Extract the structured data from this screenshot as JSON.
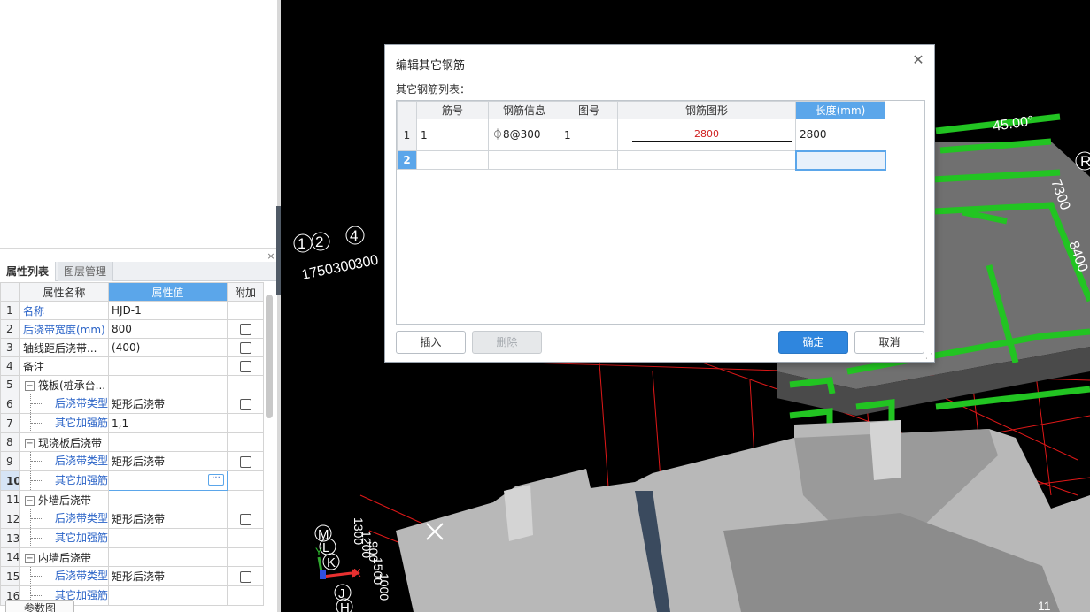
{
  "left_panel": {
    "tabs": [
      "属性列表",
      "图层管理"
    ],
    "close_glyph": "×",
    "columns": [
      "属性名称",
      "属性值",
      "附加"
    ],
    "rows": [
      {
        "num": "1",
        "name": "名称",
        "value": "HJD-1",
        "blue": true,
        "check": false,
        "tree": "",
        "child": false
      },
      {
        "num": "2",
        "name": "后浇带宽度(mm)",
        "value": "800",
        "blue": true,
        "check": true,
        "tree": "",
        "child": false
      },
      {
        "num": "3",
        "name": "轴线距后浇带...",
        "value": "(400)",
        "blue": false,
        "check": true,
        "tree": "",
        "child": false
      },
      {
        "num": "4",
        "name": "备注",
        "value": "",
        "blue": false,
        "check": true,
        "tree": "",
        "child": false
      },
      {
        "num": "5",
        "name": "筏板(桩承台...",
        "value": "",
        "blue": false,
        "check": false,
        "tree": "−",
        "child": false
      },
      {
        "num": "6",
        "name": "后浇带类型",
        "value": "矩形后浇带",
        "blue": true,
        "check": true,
        "tree": "",
        "child": true
      },
      {
        "num": "7",
        "name": "其它加强筋",
        "value": "1,1",
        "blue": true,
        "check": false,
        "tree": "",
        "child": true
      },
      {
        "num": "8",
        "name": "现浇板后浇带",
        "value": "",
        "blue": false,
        "check": false,
        "tree": "−",
        "child": false
      },
      {
        "num": "9",
        "name": "后浇带类型",
        "value": "矩形后浇带",
        "blue": true,
        "check": true,
        "tree": "",
        "child": true
      },
      {
        "num": "10",
        "name": "其它加强筋",
        "value": "",
        "blue": true,
        "check": false,
        "tree": "",
        "child": true,
        "selected": true,
        "editing": true
      },
      {
        "num": "11",
        "name": "外墙后浇带",
        "value": "",
        "blue": false,
        "check": false,
        "tree": "−",
        "child": false
      },
      {
        "num": "12",
        "name": "后浇带类型",
        "value": "矩形后浇带",
        "blue": true,
        "check": true,
        "tree": "",
        "child": true
      },
      {
        "num": "13",
        "name": "其它加强筋",
        "value": "",
        "blue": true,
        "check": false,
        "tree": "",
        "child": true
      },
      {
        "num": "14",
        "name": "内墙后浇带",
        "value": "",
        "blue": false,
        "check": false,
        "tree": "−",
        "child": false
      },
      {
        "num": "15",
        "name": "后浇带类型",
        "value": "矩形后浇带",
        "blue": true,
        "check": true,
        "tree": "",
        "child": true
      },
      {
        "num": "16",
        "name": "其它加强筋",
        "value": "",
        "blue": true,
        "check": false,
        "tree": "",
        "child": true
      }
    ],
    "ellipsis": "···",
    "bottom_button": "参数图"
  },
  "dialog": {
    "title": "编辑其它钢筋",
    "close_glyph": "✕",
    "list_label": "其它钢筋列表：",
    "columns": [
      "筋号",
      "钢筋信息",
      "图号",
      "钢筋图形",
      "长度(mm)"
    ],
    "rows": [
      {
        "num": "1",
        "bar_no": "1",
        "info": "⏀8@300",
        "fig_no": "1",
        "shape_len": "2800",
        "length": "2800"
      },
      {
        "num": "2",
        "bar_no": "",
        "info": "",
        "fig_no": "",
        "shape_len": "",
        "length": ""
      }
    ],
    "buttons": {
      "insert": "插入",
      "delete": "删除",
      "ok": "确定",
      "cancel": "取消"
    }
  },
  "viewport": {
    "axis_labels": [
      "1",
      "2",
      "4",
      "M",
      "L",
      "K",
      "J",
      "H",
      "R"
    ],
    "dim_texts": [
      "1750",
      "300",
      "300",
      "7300",
      "8400",
      "45.00°",
      "1300",
      "1200",
      "900",
      "1500",
      "1000",
      "11"
    ],
    "axis_x": "X",
    "axis_y": "Y"
  },
  "colors": {
    "accent": "#5ba6ea",
    "primary_button": "#2f86de",
    "wall_green": "#22c422",
    "grid_red": "#e01818"
  }
}
